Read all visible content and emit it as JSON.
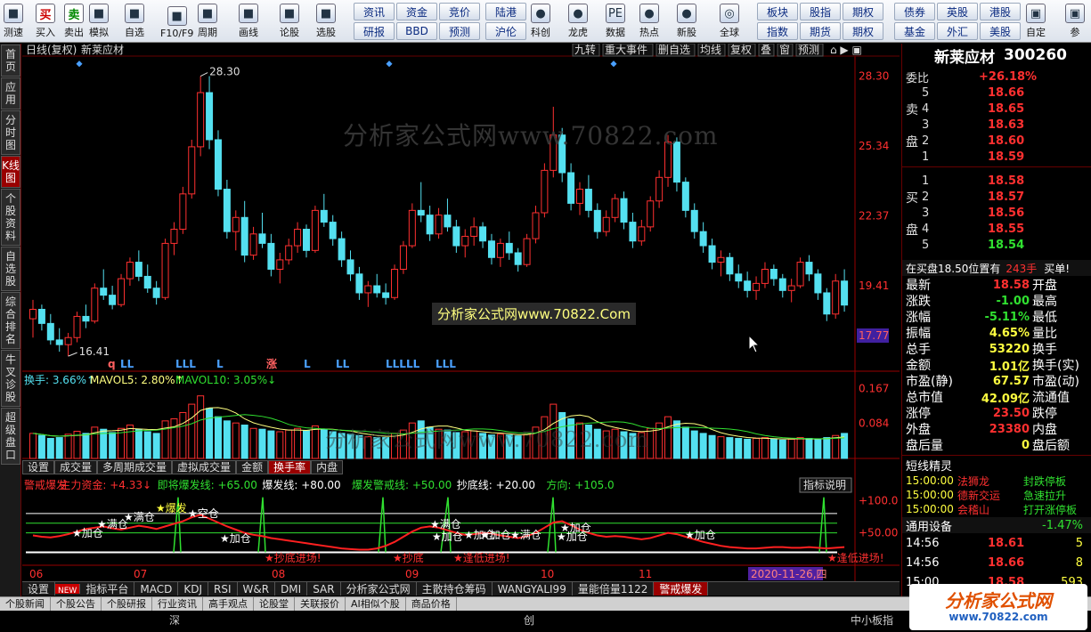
{
  "toolbar": {
    "buttons": [
      {
        "label": "测速",
        "icon": "clock-icon"
      },
      {
        "label": "买入",
        "icon": "buy-icon",
        "glyph": "买"
      },
      {
        "label": "卖出",
        "icon": "sell-icon",
        "glyph": "卖"
      },
      {
        "label": "模拟",
        "icon": "hammer-icon"
      },
      {
        "label": "自选",
        "icon": "star-icon"
      },
      {
        "label": "F10/F9",
        "icon": "f10-icon"
      },
      {
        "label": "周期",
        "icon": "cycle-icon"
      },
      {
        "label": "画线",
        "icon": "pencil-icon"
      },
      {
        "label": "论股",
        "icon": "comment-icon"
      },
      {
        "label": "选股",
        "icon": "select-icon"
      },
      {
        "label": "科创",
        "icon": "kechuang-icon"
      },
      {
        "label": "龙虎",
        "icon": "dragon-icon"
      },
      {
        "label": "数据",
        "icon": "pe-icon",
        "glyph": "PE"
      },
      {
        "label": "热点",
        "icon": "hot-icon"
      },
      {
        "label": "新股",
        "icon": "ipo-icon"
      },
      {
        "label": "全球",
        "icon": "globe-icon"
      },
      {
        "label": "自定",
        "icon": "custom-icon"
      },
      {
        "label": "参",
        "icon": "more-icon"
      }
    ],
    "group1": [
      "资讯",
      "资金",
      "竞价",
      "研报",
      "BBD",
      "预测"
    ],
    "group2": [
      "陆港",
      "沪伦"
    ],
    "group3": [
      "板块",
      "股指",
      "期权",
      "指数",
      "期货",
      "期权"
    ],
    "group4": [
      "债券",
      "英股",
      "港股",
      "基金",
      "外汇",
      "美股"
    ]
  },
  "leftbar": [
    "首页",
    "应用",
    "分时图",
    "K线图",
    "个股资料",
    "自选股",
    "综合排名",
    "牛叉诊股",
    "超级盘口"
  ],
  "header": {
    "period": "日线(复权)",
    "stock": "新莱应材",
    "tools": [
      "九转",
      "重大事件",
      "删自选",
      "均线",
      "复权",
      "叠",
      "窗",
      "预测"
    ]
  },
  "watermark": "分析家公式网www.70822.com",
  "watermark_box": "分析家公式网www.70822.Com",
  "price_axis": [
    "28.30",
    "25.34",
    "22.37",
    "19.41"
  ],
  "current_price_tag": "17.77",
  "high_label": "28.30",
  "low_label": "16.41",
  "signals": [
    "q",
    "LL",
    "LLL",
    "L",
    "涨",
    "L",
    "LL",
    "LLLLL",
    "LLL"
  ],
  "volume": {
    "label1": "换手: 3.66%",
    "label2": "MAVOL5: 2.80%",
    "label3": "MAVOL10: 3.05%",
    "axis": [
      "0.167",
      "0.084"
    ]
  },
  "mini_tabs": [
    "设置",
    "成交量",
    "多周期成交量",
    "虚拟成交量",
    "金额",
    "换手率",
    "内盘"
  ],
  "indicator": {
    "line": [
      {
        "t": "警戒爆发",
        "c": "#ff3030"
      },
      {
        "t": "主力资金: +4.33↓",
        "c": "#ff3030"
      },
      {
        "t": "即将爆发线: +65.00",
        "c": "#30e030"
      },
      {
        "t": "爆发线: +80.00",
        "c": "#fff"
      },
      {
        "t": "爆发警戒线: +50.00",
        "c": "#30e030"
      },
      {
        "t": "抄底线: +20.00",
        "c": "#fff"
      },
      {
        "t": "方向: +105.0",
        "c": "#30e030"
      }
    ],
    "button": "指标说明",
    "axis": [
      "+100.0",
      "+50.00"
    ],
    "marks": [
      "加仓",
      "满仓",
      "满仓",
      "爆发",
      "空仓",
      "加仓",
      "抄底进场!",
      "满仓",
      "加仓",
      "加仓",
      "加仓",
      "满仓",
      "加仓",
      "加仓",
      "加仓",
      "抄底",
      "逢低进场!",
      "逢低进场!"
    ]
  },
  "date_axis": [
    "06",
    "07",
    "08",
    "09",
    "10",
    "11"
  ],
  "date_tag": "2020-11-26,四",
  "bottom_tabs": [
    "设置",
    "NEW",
    "指标平台",
    "MACD",
    "KDJ",
    "RSI",
    "W&R",
    "DMI",
    "SAR",
    "分析家公式网",
    "主散持仓筹码",
    "WANGYALI99",
    "量能倍量1122",
    "警戒爆发"
  ],
  "status_tabs": [
    "个股新闻",
    "个股公告",
    "个股研报",
    "行业资讯",
    "高手观点",
    "论股堂",
    "关联报价",
    "AI相似个股",
    "商品价格"
  ],
  "status_bottom": {
    "a": "深",
    "b": "创",
    "c": "中小板指"
  },
  "quote": {
    "name": "新莱应材",
    "code": "300260",
    "weibi_label": "委比",
    "weibi": "+26.18%",
    "sell_label": "卖",
    "pan_label": "盘",
    "buy_label": "买",
    "sell": [
      [
        "5",
        "18.66"
      ],
      [
        "4",
        "18.65"
      ],
      [
        "3",
        "18.63"
      ],
      [
        "2",
        "18.60"
      ],
      [
        "1",
        "18.59"
      ]
    ],
    "buy": [
      [
        "1",
        "18.58"
      ],
      [
        "2",
        "18.57"
      ],
      [
        "3",
        "18.56"
      ],
      [
        "4",
        "18.55"
      ],
      [
        "5",
        "18.54"
      ]
    ],
    "notice": "在买盘18.50位置有",
    "notice_qty": "243手",
    "notice_action": "买单!",
    "stats": [
      [
        "最新",
        "18.58",
        "开盘",
        ""
      ],
      [
        "涨跌",
        "-1.00",
        "最高",
        ""
      ],
      [
        "涨幅",
        "-5.11%",
        "最低",
        ""
      ],
      [
        "振幅",
        "4.65%",
        "量比",
        ""
      ],
      [
        "总手",
        "53220",
        "换手",
        ""
      ],
      [
        "金额",
        "1.01亿",
        "换手(实)",
        ""
      ],
      [
        "市盈(静)",
        "67.57",
        "市盈(动)",
        ""
      ],
      [
        "总市值",
        "42.09亿",
        "流通值",
        ""
      ],
      [
        "涨停",
        "23.50",
        "跌停",
        ""
      ],
      [
        "外盘",
        "23380",
        "内盘",
        ""
      ],
      [
        "盘后量",
        "0",
        "盘后额",
        ""
      ]
    ],
    "short_title": "短线精灵",
    "short": [
      [
        "15:00:00",
        "法狮龙",
        "封跌停板"
      ],
      [
        "15:00:00",
        "德新交运",
        "急速拉升"
      ],
      [
        "15:00:00",
        "会稽山",
        "打开涨停板"
      ]
    ],
    "sector": "通用设备",
    "sector_pct": "-1.47%",
    "ticks": [
      [
        "14:56",
        "18.61",
        "5"
      ],
      [
        "14:56",
        "18.66",
        "8"
      ],
      [
        "15:00",
        "18.58",
        "593"
      ]
    ]
  },
  "logo": {
    "text": "分析家公式网",
    "url": "www.70822.com"
  },
  "chart_data": {
    "type": "candlestick",
    "ylim": [
      16.0,
      29.0
    ],
    "candles": [
      [
        18.0,
        18.8,
        17.2,
        18.4
      ],
      [
        18.4,
        18.6,
        17.5,
        17.8
      ],
      [
        17.8,
        18.2,
        16.9,
        17.1
      ],
      [
        17.1,
        17.6,
        16.6,
        16.9
      ],
      [
        16.9,
        17.4,
        16.41,
        17.2
      ],
      [
        17.2,
        18.3,
        17.0,
        18.1
      ],
      [
        18.1,
        18.6,
        17.6,
        17.9
      ],
      [
        17.9,
        19.5,
        17.8,
        19.3
      ],
      [
        19.3,
        20.1,
        18.8,
        19.0
      ],
      [
        19.0,
        19.4,
        18.4,
        18.6
      ],
      [
        18.6,
        19.9,
        18.5,
        19.7
      ],
      [
        19.7,
        20.6,
        19.4,
        20.4
      ],
      [
        20.4,
        20.9,
        19.6,
        19.8
      ],
      [
        19.8,
        20.3,
        19.1,
        19.3
      ],
      [
        19.3,
        19.6,
        18.6,
        18.9
      ],
      [
        18.9,
        21.4,
        18.8,
        21.2
      ],
      [
        21.2,
        22.1,
        20.7,
        21.8
      ],
      [
        21.8,
        23.6,
        21.6,
        23.3
      ],
      [
        23.3,
        25.6,
        23.1,
        25.3
      ],
      [
        25.3,
        28.3,
        24.9,
        27.6
      ],
      [
        27.6,
        28.3,
        25.2,
        25.6
      ],
      [
        25.6,
        26.0,
        23.2,
        23.5
      ],
      [
        23.5,
        23.9,
        21.4,
        21.7
      ],
      [
        21.7,
        22.6,
        20.9,
        22.3
      ],
      [
        22.3,
        23.0,
        20.4,
        20.7
      ],
      [
        20.7,
        21.9,
        20.5,
        21.6
      ],
      [
        21.6,
        22.5,
        21.0,
        21.2
      ],
      [
        21.2,
        21.6,
        19.8,
        20.1
      ],
      [
        20.1,
        20.8,
        19.5,
        20.5
      ],
      [
        20.5,
        21.4,
        20.3,
        21.1
      ],
      [
        21.1,
        22.1,
        20.8,
        21.8
      ],
      [
        21.8,
        22.0,
        20.6,
        20.9
      ],
      [
        20.9,
        22.8,
        20.8,
        22.6
      ],
      [
        22.6,
        23.3,
        21.9,
        22.1
      ],
      [
        22.1,
        22.4,
        21.1,
        21.4
      ],
      [
        21.4,
        21.7,
        20.2,
        20.5
      ],
      [
        20.5,
        20.9,
        19.6,
        19.9
      ],
      [
        19.9,
        20.2,
        18.8,
        19.1
      ],
      [
        19.1,
        19.6,
        18.5,
        19.4
      ],
      [
        19.4,
        19.9,
        18.9,
        19.1
      ],
      [
        19.1,
        19.5,
        18.6,
        18.9
      ],
      [
        18.9,
        20.3,
        18.8,
        20.1
      ],
      [
        20.1,
        21.3,
        19.9,
        21.1
      ],
      [
        21.1,
        22.9,
        21.0,
        22.6
      ],
      [
        22.6,
        23.8,
        22.1,
        22.4
      ],
      [
        22.4,
        22.8,
        21.3,
        21.6
      ],
      [
        21.6,
        22.7,
        21.4,
        22.4
      ],
      [
        22.4,
        23.1,
        21.7,
        21.9
      ],
      [
        21.9,
        22.2,
        20.8,
        21.1
      ],
      [
        21.1,
        21.8,
        20.6,
        21.5
      ],
      [
        21.5,
        22.3,
        21.1,
        21.9
      ],
      [
        21.9,
        22.1,
        21.0,
        21.3
      ],
      [
        21.3,
        21.6,
        20.3,
        20.6
      ],
      [
        20.6,
        21.4,
        20.2,
        21.2
      ],
      [
        21.2,
        21.7,
        20.5,
        20.8
      ],
      [
        20.8,
        21.0,
        20.0,
        20.3
      ],
      [
        20.3,
        21.6,
        20.2,
        21.4
      ],
      [
        21.4,
        22.8,
        21.2,
        22.5
      ],
      [
        22.5,
        24.6,
        22.3,
        24.3
      ],
      [
        24.3,
        27.0,
        24.0,
        25.8
      ],
      [
        25.8,
        26.1,
        23.8,
        24.2
      ],
      [
        24.2,
        24.6,
        22.6,
        22.9
      ],
      [
        22.9,
        23.8,
        22.4,
        23.5
      ],
      [
        23.5,
        24.1,
        22.3,
        22.6
      ],
      [
        22.6,
        22.9,
        21.4,
        21.7
      ],
      [
        21.7,
        22.6,
        21.5,
        22.3
      ],
      [
        22.3,
        23.3,
        22.1,
        23.1
      ],
      [
        23.1,
        23.4,
        21.8,
        22.1
      ],
      [
        22.1,
        22.5,
        21.0,
        21.3
      ],
      [
        21.3,
        22.2,
        21.1,
        21.9
      ],
      [
        21.9,
        23.2,
        21.7,
        23.0
      ],
      [
        23.0,
        24.3,
        22.7,
        24.0
      ],
      [
        24.0,
        25.8,
        23.6,
        25.5
      ],
      [
        25.5,
        25.7,
        23.4,
        23.8
      ],
      [
        23.8,
        24.0,
        22.3,
        22.6
      ],
      [
        22.6,
        22.9,
        21.4,
        21.7
      ],
      [
        21.7,
        22.1,
        20.8,
        21.1
      ],
      [
        21.1,
        21.4,
        20.1,
        20.4
      ],
      [
        20.4,
        20.9,
        19.8,
        20.6
      ],
      [
        20.6,
        20.8,
        19.6,
        19.9
      ],
      [
        19.9,
        20.3,
        19.3,
        19.6
      ],
      [
        19.6,
        20.0,
        18.9,
        19.2
      ],
      [
        19.2,
        19.8,
        18.8,
        19.5
      ],
      [
        19.5,
        20.4,
        19.3,
        20.1
      ],
      [
        20.1,
        20.3,
        19.4,
        19.7
      ],
      [
        19.7,
        19.9,
        18.9,
        19.2
      ],
      [
        19.2,
        19.7,
        18.7,
        19.4
      ],
      [
        19.4,
        20.6,
        19.3,
        20.4
      ],
      [
        20.4,
        20.7,
        19.6,
        19.9
      ],
      [
        19.9,
        20.1,
        18.8,
        19.1
      ],
      [
        19.1,
        19.3,
        17.9,
        18.2
      ],
      [
        18.2,
        19.9,
        18.0,
        19.6
      ],
      [
        19.6,
        20.1,
        18.3,
        18.58
      ]
    ],
    "volumes": [
      0.06,
      0.055,
      0.048,
      0.05,
      0.058,
      0.065,
      0.06,
      0.075,
      0.07,
      0.062,
      0.072,
      0.08,
      0.07,
      0.064,
      0.06,
      0.09,
      0.095,
      0.11,
      0.13,
      0.15,
      0.12,
      0.1,
      0.09,
      0.085,
      0.08,
      0.072,
      0.07,
      0.066,
      0.064,
      0.068,
      0.072,
      0.066,
      0.078,
      0.07,
      0.064,
      0.06,
      0.058,
      0.055,
      0.052,
      0.05,
      0.05,
      0.06,
      0.068,
      0.085,
      0.09,
      0.075,
      0.07,
      0.068,
      0.062,
      0.064,
      0.066,
      0.06,
      0.056,
      0.058,
      0.056,
      0.054,
      0.06,
      0.075,
      0.1,
      0.13,
      0.11,
      0.095,
      0.085,
      0.08,
      0.07,
      0.066,
      0.07,
      0.064,
      0.06,
      0.062,
      0.072,
      0.085,
      0.1,
      0.09,
      0.075,
      0.066,
      0.06,
      0.055,
      0.052,
      0.05,
      0.048,
      0.046,
      0.048,
      0.05,
      0.046,
      0.044,
      0.046,
      0.05,
      0.048,
      0.045,
      0.05,
      0.055,
      0.06
    ],
    "indicator_line": [
      46,
      44,
      43,
      45,
      48,
      52,
      56,
      58,
      60,
      57,
      55,
      58,
      61,
      59,
      56,
      60,
      64,
      68,
      74,
      78,
      72,
      66,
      60,
      55,
      50,
      47,
      45,
      42,
      40,
      38,
      36,
      34,
      32,
      30,
      28,
      26,
      25,
      24,
      24,
      26,
      30,
      36,
      44,
      52,
      58,
      60,
      58,
      54,
      50,
      47,
      48,
      50,
      49,
      46,
      44,
      42,
      45,
      50,
      58,
      66,
      68,
      62,
      55,
      50,
      46,
      44,
      45,
      44,
      42,
      40,
      42,
      46,
      50,
      48,
      44,
      40,
      36,
      33,
      30,
      28,
      27,
      26,
      26,
      27,
      28,
      28,
      27,
      27,
      28,
      27,
      26,
      27,
      28
    ]
  }
}
